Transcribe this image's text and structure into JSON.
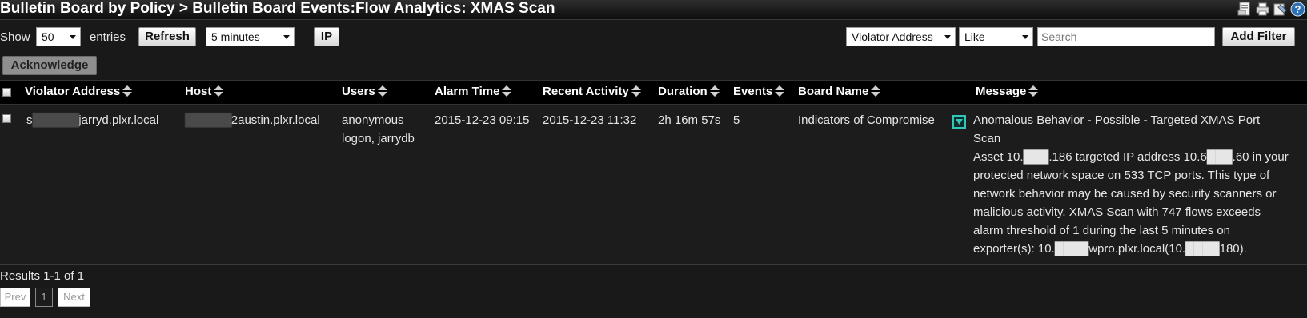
{
  "window": {
    "title": "Bulletin Board by Policy > Bulletin Board Events:Flow Analytics: XMAS Scan",
    "icons": [
      "export-pdf-icon",
      "print-icon",
      "settings-icon",
      "help-icon"
    ]
  },
  "controls": {
    "show_label": "Show",
    "entries_value": "50",
    "entries_label": "entries",
    "refresh_label": "Refresh",
    "interval_value": "5 minutes",
    "ip_label": "IP",
    "filter_field_value": "Violator Address",
    "filter_op_value": "Like",
    "search_placeholder": "Search",
    "add_filter_label": "Add Filter",
    "acknowledge_label": "Acknowledge"
  },
  "table": {
    "headers": [
      "Violator Address",
      "Host",
      "Users",
      "Alarm Time",
      "Recent Activity",
      "Duration",
      "Events",
      "Board Name",
      "Message"
    ],
    "rows": [
      {
        "violator_prefix": "s",
        "violator_masked": "██████",
        "violator_suffix": "jarryd.plxr.local",
        "host_masked": "██████",
        "host_suffix": "2austin.plxr.local",
        "users_line1": "anonymous",
        "users_line2": "logon, jarrydb",
        "alarm_time": "2015-12-23 09:15",
        "recent_activity": "2015-12-23 11:32",
        "duration": "2h 16m 57s",
        "events": "5",
        "board_name": "Indicators of Compromise",
        "message_lines": [
          "Anomalous Behavior - Possible - Targeted XMAS Port",
          "Scan",
          "Asset 10.███.186 targeted IP address 10.6███.60 in your",
          "protected network space on 533 TCP ports. This type of",
          "network behavior may be caused by security scanners or",
          "malicious activity. XMAS Scan with 747 flows exceeds",
          "alarm threshold of 1 during the last 5 minutes on",
          "exporter(s): 10.████wpro.plxr.local(10.████180)."
        ]
      }
    ]
  },
  "footer": {
    "results_text": "Results 1-1 of 1",
    "prev_label": "Prev",
    "page_number": "1",
    "next_label": "Next"
  },
  "colors": {
    "background": "#191919",
    "header_background": "#000000",
    "expand_accent": "#31c7b7"
  }
}
